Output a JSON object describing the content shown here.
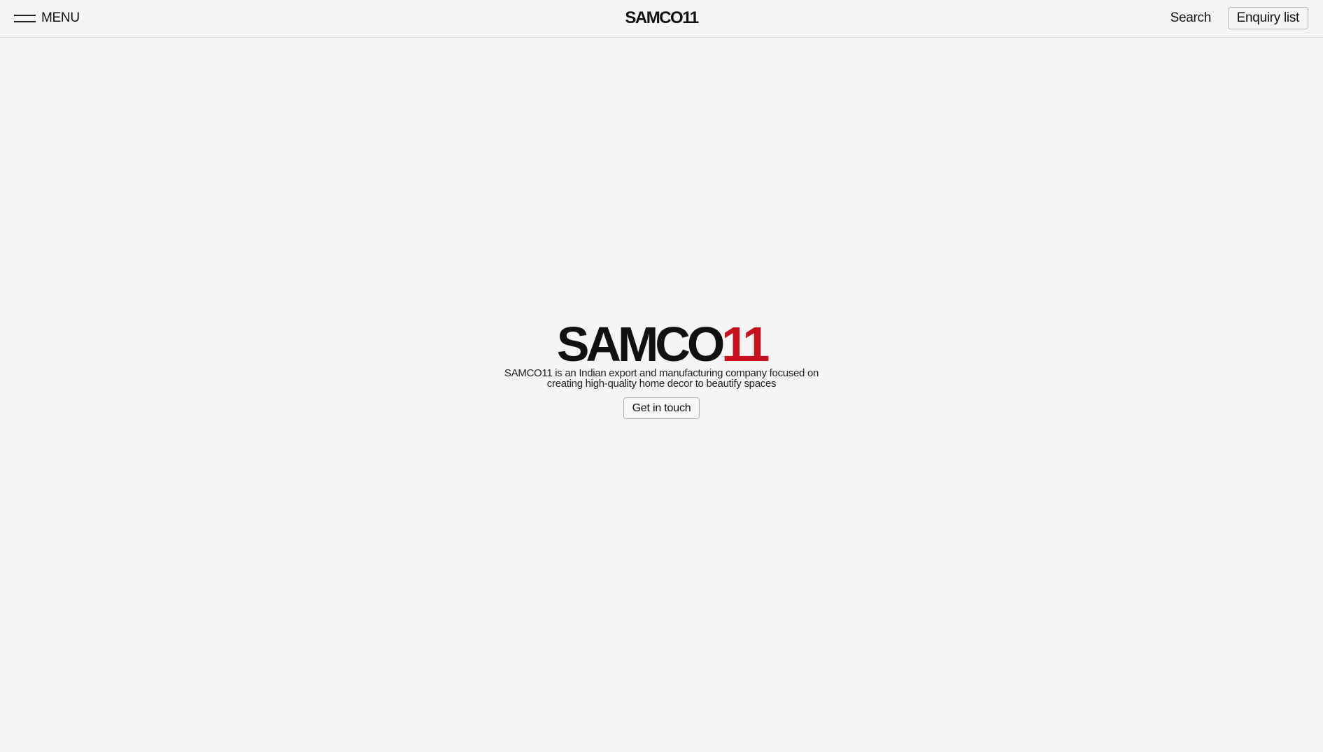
{
  "header": {
    "menu_label": "MENU",
    "logo": "SAMCO11",
    "search_label": "Search",
    "enquiry_label": "Enquiry list"
  },
  "hero": {
    "logo_letters": "SAMCO",
    "logo_number": "11",
    "description": "SAMCO11 is an Indian export and manufacturing company focused on creating high-quality home decor to beautify spaces",
    "cta_label": "Get in touch"
  },
  "colors": {
    "background": "#f5f5f5",
    "brand_accent": "#c8111c",
    "text": "#111111"
  },
  "icons": {
    "menu": "hamburger-icon"
  }
}
